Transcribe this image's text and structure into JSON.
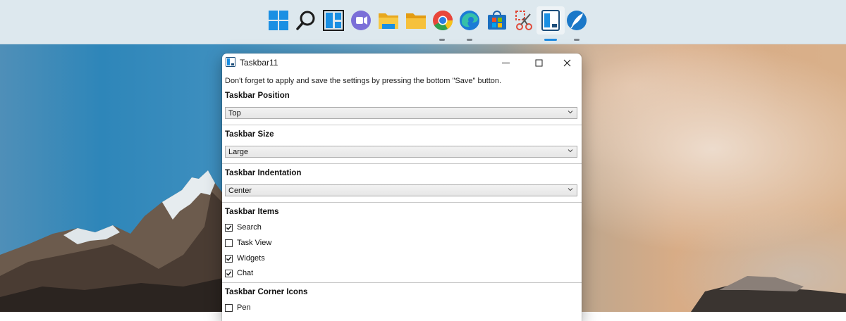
{
  "taskbar": {
    "icons": [
      {
        "name": "start-icon"
      },
      {
        "name": "search-icon"
      },
      {
        "name": "widgets-icon"
      },
      {
        "name": "teams-chat-icon"
      },
      {
        "name": "file-explorer-icon"
      },
      {
        "name": "folder-icon"
      },
      {
        "name": "chrome-icon"
      },
      {
        "name": "edge-icon"
      },
      {
        "name": "store-icon"
      },
      {
        "name": "snipping-tool-icon"
      },
      {
        "name": "taskbar11-icon",
        "active": true
      },
      {
        "name": "quill-app-icon"
      }
    ],
    "accent_color": "#1f8ae0"
  },
  "window": {
    "title": "Taskbar11",
    "hint": "Don't forget to apply and save the settings by pressing the bottom \"Save\" button.",
    "sections": {
      "position": {
        "title": "Taskbar Position",
        "value": "Top"
      },
      "size": {
        "title": "Taskbar Size",
        "value": "Large"
      },
      "indentation": {
        "title": "Taskbar Indentation",
        "value": "Center"
      },
      "items": {
        "title": "Taskbar Items",
        "options": [
          {
            "label": "Search",
            "checked": true
          },
          {
            "label": "Task View",
            "checked": false
          },
          {
            "label": "Widgets",
            "checked": true
          },
          {
            "label": "Chat",
            "checked": true
          }
        ]
      },
      "corner": {
        "title": "Taskbar Corner Icons",
        "options": [
          {
            "label": "Pen",
            "checked": false
          }
        ]
      }
    }
  }
}
